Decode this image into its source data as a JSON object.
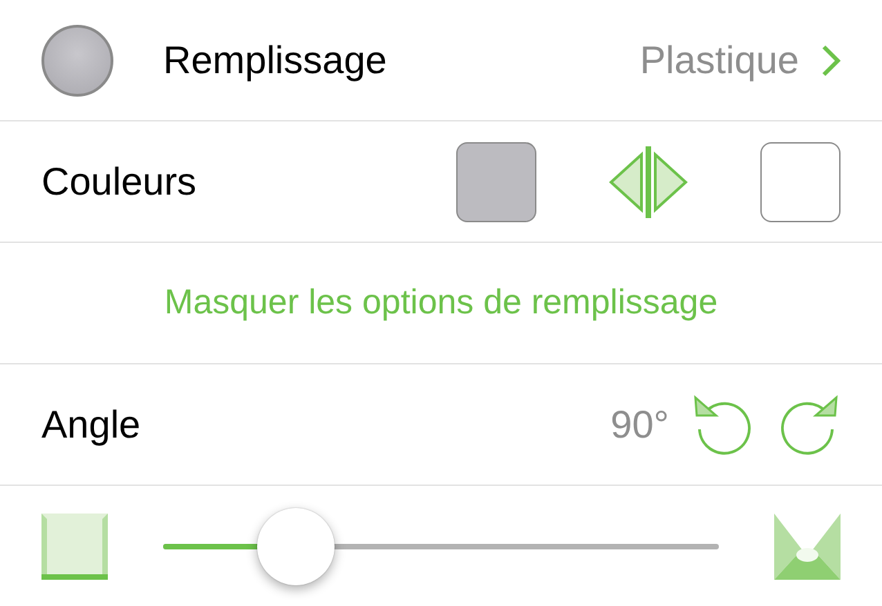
{
  "fill_row": {
    "label": "Remplissage",
    "value": "Plastique"
  },
  "colors_row": {
    "label": "Couleurs",
    "swatches": [
      {
        "color": "#bcbbc0"
      },
      {
        "color": "#ffffff"
      }
    ]
  },
  "toggle_link": "Masquer les options de remplissage",
  "angle_row": {
    "label": "Angle",
    "value": "90°"
  },
  "blend_slider": {
    "level": 0.24
  }
}
